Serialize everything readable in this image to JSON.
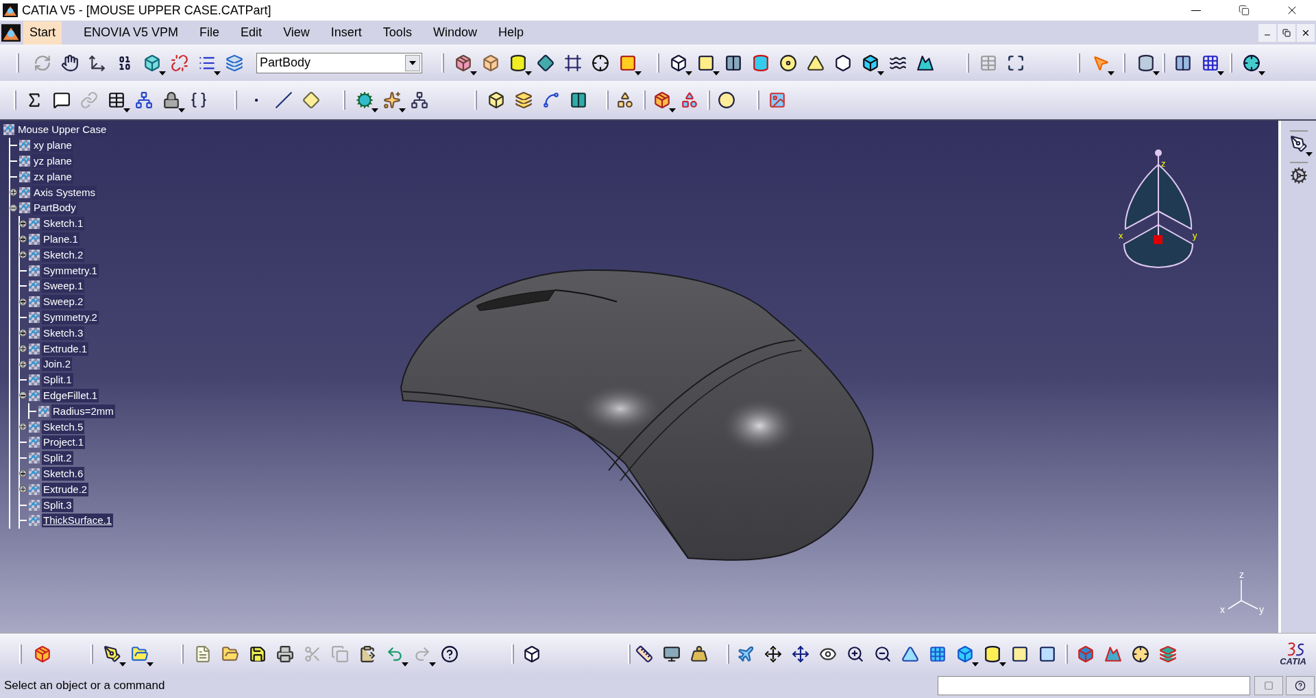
{
  "window": {
    "title": "CATIA V5 - [MOUSE UPPER CASE.CATPart]"
  },
  "menu_bar": {
    "items": [
      {
        "label": "Start",
        "selected": true
      },
      {
        "label": "ENOVIA V5 VPM",
        "selected": false
      },
      {
        "label": "File",
        "selected": false
      },
      {
        "label": "Edit",
        "selected": false
      },
      {
        "label": "View",
        "selected": false
      },
      {
        "label": "Insert",
        "selected": false
      },
      {
        "label": "Tools",
        "selected": false
      },
      {
        "label": "Window",
        "selected": false
      },
      {
        "label": "Help",
        "selected": false
      }
    ]
  },
  "toolbar": {
    "body_selector": {
      "value": "PartBody"
    }
  },
  "tree": {
    "root": {
      "label": "Mouse Upper Case",
      "children": [
        {
          "label": "xy plane"
        },
        {
          "label": "yz plane"
        },
        {
          "label": "zx plane"
        },
        {
          "label": "Axis Systems",
          "expanded": false
        },
        {
          "label": "PartBody",
          "expanded": true,
          "children": [
            {
              "label": "Sketch.1",
              "expanded": false,
              "current": false
            },
            {
              "label": "Plane.1",
              "expanded": false,
              "current": false
            },
            {
              "label": "Sketch.2",
              "expanded": false,
              "current": false
            },
            {
              "label": "Symmetry.1",
              "current": false
            },
            {
              "label": "Sweep.1",
              "current": false
            },
            {
              "label": "Sweep.2",
              "expanded": false,
              "current": false
            },
            {
              "label": "Symmetry.2",
              "current": false
            },
            {
              "label": "Sketch.3",
              "expanded": false,
              "current": false
            },
            {
              "label": "Extrude.1",
              "expanded": false,
              "current": false
            },
            {
              "label": "Join.2",
              "expanded": false,
              "current": false
            },
            {
              "label": "Split.1",
              "current": false
            },
            {
              "label": "EdgeFillet.1",
              "expanded": true,
              "current": false,
              "children": [
                {
                  "label": "Radius=2mm"
                }
              ]
            },
            {
              "label": "Sketch.5",
              "expanded": false,
              "current": false
            },
            {
              "label": "Project.1",
              "current": false
            },
            {
              "label": "Split.2",
              "current": false
            },
            {
              "label": "Sketch.6",
              "expanded": false,
              "current": false
            },
            {
              "label": "Extrude.2",
              "expanded": false,
              "current": false
            },
            {
              "label": "Split.3",
              "current": false
            },
            {
              "label": "ThickSurface.1",
              "current": true
            }
          ]
        }
      ]
    }
  },
  "compass": {
    "labels": [
      "z",
      "x",
      "y"
    ]
  },
  "axis_triad": {
    "labels": [
      "z",
      "x",
      "y"
    ]
  },
  "logo": {
    "text": "CATIA"
  },
  "status_bar": {
    "message": "Select an object or a command"
  }
}
